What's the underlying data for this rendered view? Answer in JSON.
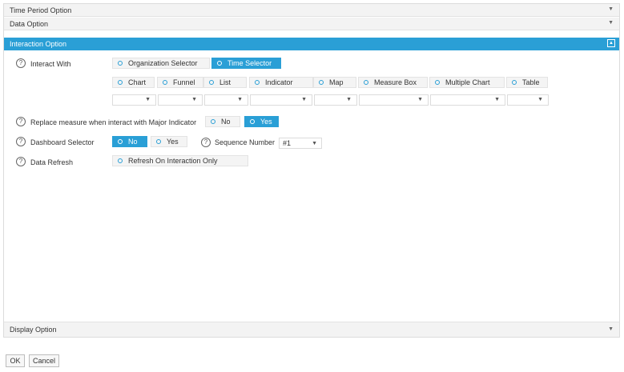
{
  "accordion": {
    "time_period": "Time Period Option",
    "data": "Data Option",
    "interaction": "Interaction Option",
    "display": "Display Option"
  },
  "interaction": {
    "interact_with": {
      "label": "Interact With",
      "options": [
        "Organization Selector",
        "Time Selector"
      ],
      "selected": "Time Selector"
    },
    "targets": [
      "Chart",
      "Funnel",
      "List",
      "Indicator",
      "Map",
      "Measure Box",
      "Multiple Chart",
      "Table"
    ],
    "replace_measure": {
      "label": "Replace measure when interact with Major Indicator",
      "no": "No",
      "yes": "Yes",
      "selected": "Yes"
    },
    "dashboard_selector": {
      "label": "Dashboard Selector",
      "no": "No",
      "yes": "Yes",
      "selected": "No"
    },
    "sequence_number": {
      "label": "Sequence Number",
      "value": "#1"
    },
    "data_refresh": {
      "label": "Data Refresh",
      "option": "Refresh On Interaction Only"
    }
  },
  "buttons": {
    "ok": "OK",
    "cancel": "Cancel"
  },
  "icons": {
    "help": "?",
    "caret": "▼",
    "collapse": "▲"
  },
  "colors": {
    "accent": "#2a9fd6",
    "header_bg": "#f3f3f3",
    "border": "#dcdcdc"
  }
}
